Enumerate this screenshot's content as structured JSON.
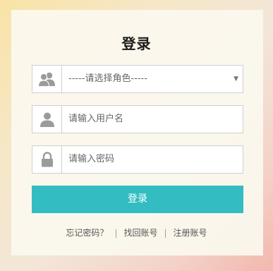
{
  "form": {
    "title": "登录",
    "role_select": {
      "selected": "-----请选择角色-----",
      "icon": "users-icon",
      "caret_icon": "caret-down-icon"
    },
    "username": {
      "placeholder": "请输入用户名",
      "icon": "user-icon"
    },
    "password": {
      "placeholder": "请输入密码",
      "icon": "lock-icon"
    },
    "submit_label": "登录"
  },
  "links": {
    "forgot_password": "忘记密码？",
    "recover_account": "找回账号",
    "register": "注册账号",
    "separator": "|"
  },
  "colors": {
    "accent": "#33bdc3",
    "icon_gray": "#9b9b9b"
  }
}
